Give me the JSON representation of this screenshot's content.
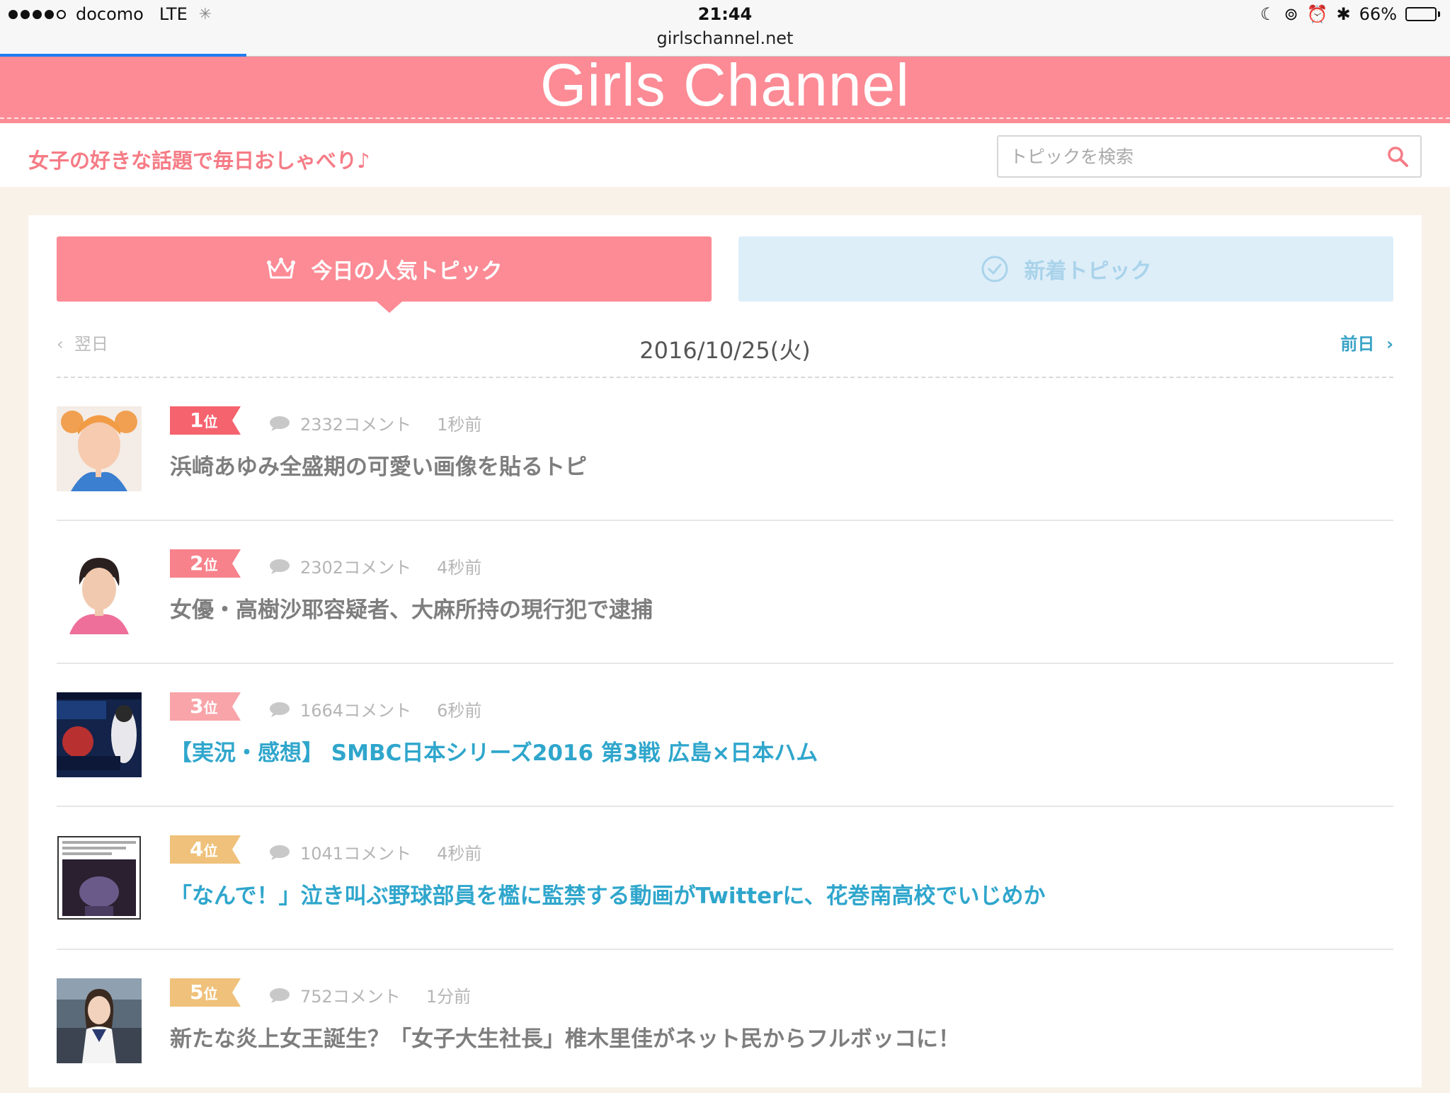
{
  "status_bar": {
    "carrier": "docomo",
    "network": "LTE",
    "time": "21:44",
    "url": "girlschannel.net",
    "battery_text": "66%",
    "battery_level": 0.66,
    "page_load_progress": 0.17
  },
  "header": {
    "logo": "Girls Channel",
    "tagline": "女子の好きな話題で毎日おしゃべり♪",
    "search_placeholder": "トピックを検索"
  },
  "tabs": {
    "popular": "今日の人気トピック",
    "new": "新着トピック"
  },
  "date_nav": {
    "prev": "翌日",
    "date": "2016/10/25(火)",
    "next": "前日"
  },
  "topics": [
    {
      "rank_num": "1",
      "rank_unit": "位",
      "comments": "2332コメント",
      "time": "1秒前",
      "title": "浜崎あゆみ全盛期の可愛い画像を貼るトピ",
      "rank_color": "#f5636e"
    },
    {
      "rank_num": "2",
      "rank_unit": "位",
      "comments": "2302コメント",
      "time": "4秒前",
      "title": "女優・高樹沙耶容疑者、大麻所持の現行犯で逮捕",
      "rank_color": "#f7828b"
    },
    {
      "rank_num": "3",
      "rank_unit": "位",
      "comments": "1664コメント",
      "time": "6秒前",
      "title": "【実況・感想】 SMBC日本シリーズ2016 第3戦 広島×日本ハム",
      "rank_color": "#f8a4a9"
    },
    {
      "rank_num": "4",
      "rank_unit": "位",
      "comments": "1041コメント",
      "time": "4秒前",
      "title": "「なんで！」泣き叫ぶ野球部員を檻に監禁する動画がTwitterに、花巻南高校でいじめか",
      "rank_color": "#efc17a"
    },
    {
      "rank_num": "5",
      "rank_unit": "位",
      "comments": "752コメント",
      "time": "1分前",
      "title": "新たな炎上女王誕生？「女子大生社長」椎木里佳がネット民からフルボッコに！",
      "rank_color": "#efc17a"
    }
  ]
}
